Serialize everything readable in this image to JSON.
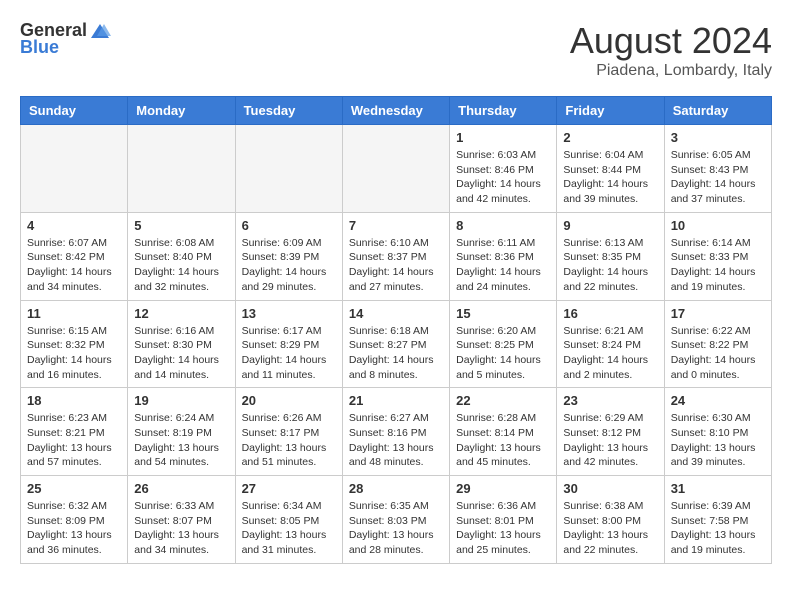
{
  "header": {
    "logo_general": "General",
    "logo_blue": "Blue",
    "month_year": "August 2024",
    "location": "Piadena, Lombardy, Italy"
  },
  "weekdays": [
    "Sunday",
    "Monday",
    "Tuesday",
    "Wednesday",
    "Thursday",
    "Friday",
    "Saturday"
  ],
  "weeks": [
    [
      {
        "day": "",
        "info": ""
      },
      {
        "day": "",
        "info": ""
      },
      {
        "day": "",
        "info": ""
      },
      {
        "day": "",
        "info": ""
      },
      {
        "day": "1",
        "info": "Sunrise: 6:03 AM\nSunset: 8:46 PM\nDaylight: 14 hours\nand 42 minutes."
      },
      {
        "day": "2",
        "info": "Sunrise: 6:04 AM\nSunset: 8:44 PM\nDaylight: 14 hours\nand 39 minutes."
      },
      {
        "day": "3",
        "info": "Sunrise: 6:05 AM\nSunset: 8:43 PM\nDaylight: 14 hours\nand 37 minutes."
      }
    ],
    [
      {
        "day": "4",
        "info": "Sunrise: 6:07 AM\nSunset: 8:42 PM\nDaylight: 14 hours\nand 34 minutes."
      },
      {
        "day": "5",
        "info": "Sunrise: 6:08 AM\nSunset: 8:40 PM\nDaylight: 14 hours\nand 32 minutes."
      },
      {
        "day": "6",
        "info": "Sunrise: 6:09 AM\nSunset: 8:39 PM\nDaylight: 14 hours\nand 29 minutes."
      },
      {
        "day": "7",
        "info": "Sunrise: 6:10 AM\nSunset: 8:37 PM\nDaylight: 14 hours\nand 27 minutes."
      },
      {
        "day": "8",
        "info": "Sunrise: 6:11 AM\nSunset: 8:36 PM\nDaylight: 14 hours\nand 24 minutes."
      },
      {
        "day": "9",
        "info": "Sunrise: 6:13 AM\nSunset: 8:35 PM\nDaylight: 14 hours\nand 22 minutes."
      },
      {
        "day": "10",
        "info": "Sunrise: 6:14 AM\nSunset: 8:33 PM\nDaylight: 14 hours\nand 19 minutes."
      }
    ],
    [
      {
        "day": "11",
        "info": "Sunrise: 6:15 AM\nSunset: 8:32 PM\nDaylight: 14 hours\nand 16 minutes."
      },
      {
        "day": "12",
        "info": "Sunrise: 6:16 AM\nSunset: 8:30 PM\nDaylight: 14 hours\nand 14 minutes."
      },
      {
        "day": "13",
        "info": "Sunrise: 6:17 AM\nSunset: 8:29 PM\nDaylight: 14 hours\nand 11 minutes."
      },
      {
        "day": "14",
        "info": "Sunrise: 6:18 AM\nSunset: 8:27 PM\nDaylight: 14 hours\nand 8 minutes."
      },
      {
        "day": "15",
        "info": "Sunrise: 6:20 AM\nSunset: 8:25 PM\nDaylight: 14 hours\nand 5 minutes."
      },
      {
        "day": "16",
        "info": "Sunrise: 6:21 AM\nSunset: 8:24 PM\nDaylight: 14 hours\nand 2 minutes."
      },
      {
        "day": "17",
        "info": "Sunrise: 6:22 AM\nSunset: 8:22 PM\nDaylight: 14 hours\nand 0 minutes."
      }
    ],
    [
      {
        "day": "18",
        "info": "Sunrise: 6:23 AM\nSunset: 8:21 PM\nDaylight: 13 hours\nand 57 minutes."
      },
      {
        "day": "19",
        "info": "Sunrise: 6:24 AM\nSunset: 8:19 PM\nDaylight: 13 hours\nand 54 minutes."
      },
      {
        "day": "20",
        "info": "Sunrise: 6:26 AM\nSunset: 8:17 PM\nDaylight: 13 hours\nand 51 minutes."
      },
      {
        "day": "21",
        "info": "Sunrise: 6:27 AM\nSunset: 8:16 PM\nDaylight: 13 hours\nand 48 minutes."
      },
      {
        "day": "22",
        "info": "Sunrise: 6:28 AM\nSunset: 8:14 PM\nDaylight: 13 hours\nand 45 minutes."
      },
      {
        "day": "23",
        "info": "Sunrise: 6:29 AM\nSunset: 8:12 PM\nDaylight: 13 hours\nand 42 minutes."
      },
      {
        "day": "24",
        "info": "Sunrise: 6:30 AM\nSunset: 8:10 PM\nDaylight: 13 hours\nand 39 minutes."
      }
    ],
    [
      {
        "day": "25",
        "info": "Sunrise: 6:32 AM\nSunset: 8:09 PM\nDaylight: 13 hours\nand 36 minutes."
      },
      {
        "day": "26",
        "info": "Sunrise: 6:33 AM\nSunset: 8:07 PM\nDaylight: 13 hours\nand 34 minutes."
      },
      {
        "day": "27",
        "info": "Sunrise: 6:34 AM\nSunset: 8:05 PM\nDaylight: 13 hours\nand 31 minutes."
      },
      {
        "day": "28",
        "info": "Sunrise: 6:35 AM\nSunset: 8:03 PM\nDaylight: 13 hours\nand 28 minutes."
      },
      {
        "day": "29",
        "info": "Sunrise: 6:36 AM\nSunset: 8:01 PM\nDaylight: 13 hours\nand 25 minutes."
      },
      {
        "day": "30",
        "info": "Sunrise: 6:38 AM\nSunset: 8:00 PM\nDaylight: 13 hours\nand 22 minutes."
      },
      {
        "day": "31",
        "info": "Sunrise: 6:39 AM\nSunset: 7:58 PM\nDaylight: 13 hours\nand 19 minutes."
      }
    ]
  ]
}
